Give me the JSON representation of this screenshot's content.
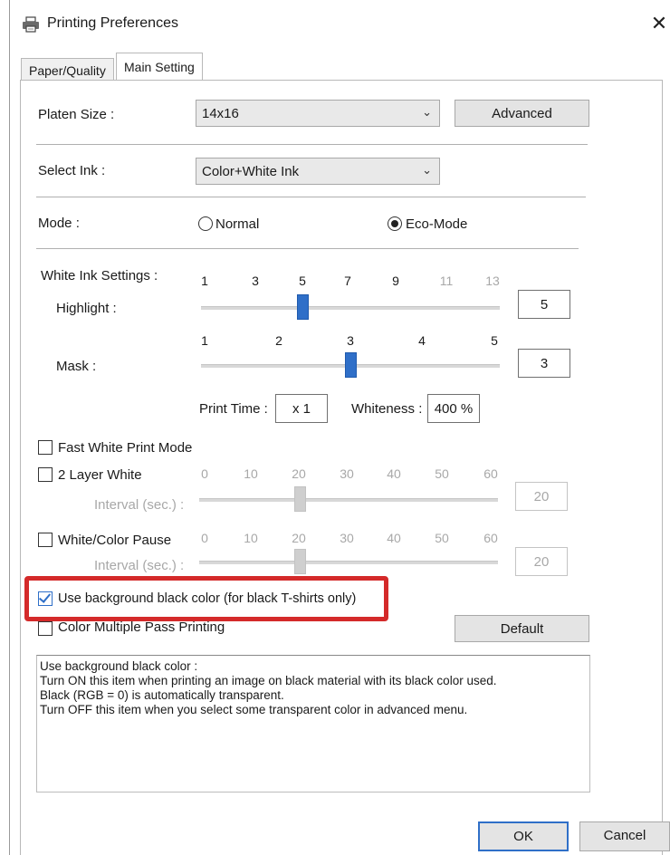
{
  "window": {
    "title": "Printing Preferences",
    "close_glyph": "✕",
    "icon": "printer-icon"
  },
  "tabs": [
    {
      "label": "Paper/Quality",
      "active": false
    },
    {
      "label": "Main Setting",
      "active": true
    }
  ],
  "platen": {
    "label": "Platen Size :",
    "value": "14x16",
    "advanced_label": "Advanced"
  },
  "ink": {
    "label": "Select Ink :",
    "value": "Color+White Ink"
  },
  "mode": {
    "label": "Mode :",
    "option_normal": "Normal",
    "option_eco": "Eco-Mode",
    "selected": "Eco-Mode"
  },
  "white_ink": {
    "label": "White Ink Settings :",
    "highlight": {
      "label": "Highlight :",
      "ticks": [
        "1",
        "3",
        "5",
        "7",
        "9",
        "11",
        "13"
      ],
      "value": "5"
    },
    "mask": {
      "label": "Mask :",
      "ticks": [
        "1",
        "2",
        "3",
        "4",
        "5"
      ],
      "value": "3"
    },
    "print_time_label": "Print Time :",
    "print_time_value": "x 1",
    "whiteness_label": "Whiteness :",
    "whiteness_value": "400 %"
  },
  "fast_white": {
    "label": "Fast White Print Mode",
    "checked": false
  },
  "two_layer": {
    "label": "2 Layer White",
    "checked": false,
    "ticks": [
      "0",
      "10",
      "20",
      "30",
      "40",
      "50",
      "60"
    ],
    "interval_label": "Interval (sec.) :",
    "value": "20"
  },
  "pause": {
    "label": "White/Color Pause",
    "checked": false,
    "ticks": [
      "0",
      "10",
      "20",
      "30",
      "40",
      "50",
      "60"
    ],
    "interval_label": "Interval (sec.) :",
    "value": "20"
  },
  "bg_black": {
    "label": "Use background black color (for black T-shirts only)",
    "checked": true
  },
  "multi_pass": {
    "label": "Color Multiple Pass Printing",
    "checked": false
  },
  "default_label": "Default",
  "description": [
    "Use background black color :",
    "Turn ON this item when printing an image on black material with its black color used.",
    "Black (RGB = 0) is automatically transparent.",
    "Turn OFF this item when you select some transparent color in advanced menu."
  ],
  "footer": {
    "ok_label": "OK",
    "cancel_label": "Cancel"
  },
  "colors": {
    "accent": "#2f6fc8",
    "highlight_frame": "#d42a2a"
  }
}
